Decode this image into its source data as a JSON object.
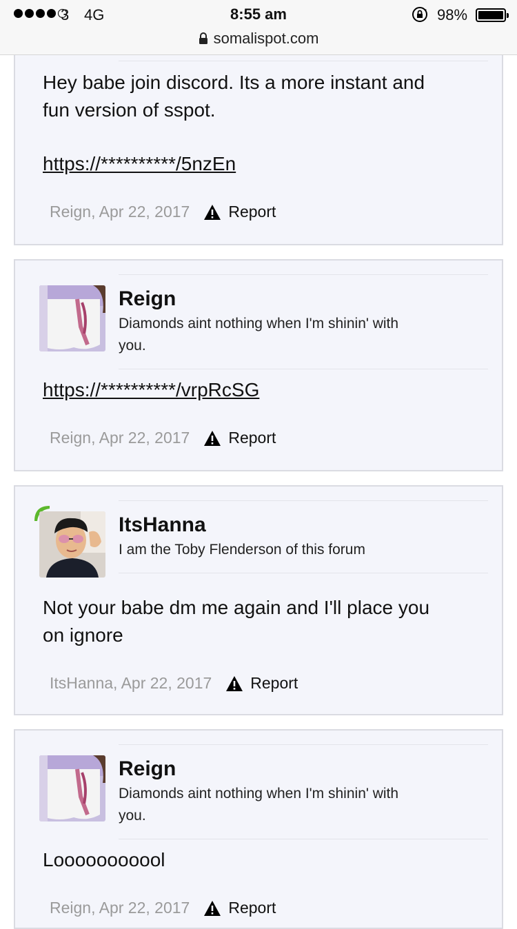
{
  "status_bar": {
    "carrier": "3",
    "network": "4G",
    "time": "8:55 am",
    "battery": "98%"
  },
  "browser": {
    "url": "somalispot.com"
  },
  "posts": [
    {
      "message_lines": [
        "Hey babe join discord. Its a more instant and",
        "fun version of sspot."
      ],
      "link": "https://**********/5nzEn",
      "author_date": "Reign, Apr 22, 2017",
      "report_label": "Report"
    },
    {
      "username": "Reign",
      "usertitle_lines": [
        "Diamonds aint nothing when I'm shinin' with",
        "you."
      ],
      "link": "https://**********/vrpRcSG",
      "author_date": "Reign, Apr 22, 2017",
      "report_label": "Report"
    },
    {
      "username": "ItsHanna",
      "usertitle_lines": [
        "I am the Toby Flenderson of this forum"
      ],
      "message_lines": [
        "Not your babe dm me again and I'll place you",
        "on ignore"
      ],
      "author_date": "ItsHanna, Apr 22, 2017",
      "report_label": "Report"
    },
    {
      "username": "Reign",
      "usertitle_lines": [
        "Diamonds aint nothing when I'm shinin' with",
        "you."
      ],
      "message_lines": [
        "Looooooooool"
      ],
      "author_date": "Reign, Apr 22, 2017",
      "report_label": "Report"
    }
  ],
  "icons": [
    "lock-icon",
    "rotation-lock-icon",
    "warning-icon",
    "leaf-badge-icon"
  ]
}
